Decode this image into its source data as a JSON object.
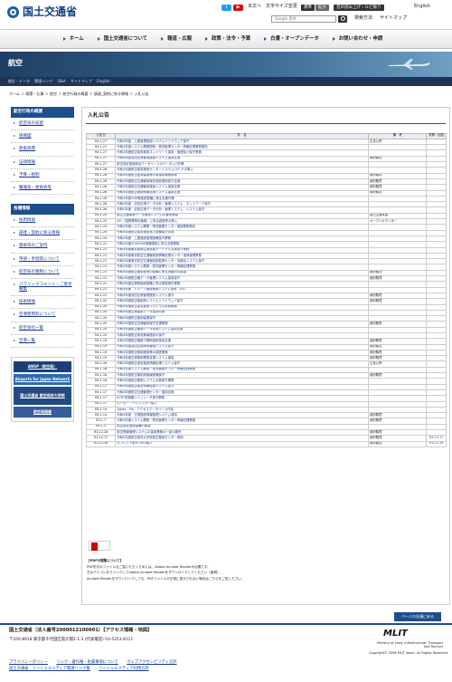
{
  "header": {
    "logo": "国土交通省",
    "text_size": "本文へ　文字サイズ変更",
    "size_std": "標準",
    "size_big": "拡大",
    "voice": "音声読み上げ・ルビ振り",
    "english": "English",
    "search_placeholder": "Google 提供",
    "search_guide": "検索方法",
    "sitemap": "サイトマップ"
  },
  "nav": [
    "ホーム",
    "国土交通省について",
    "報道・広報",
    "政策・法令・予算",
    "白書・オープンデータ",
    "お問い合わせ・申請"
  ],
  "banner": {
    "title": "航空"
  },
  "subnav": [
    "統計・データ",
    "関連リンク",
    "Q&A",
    "サイトマップ",
    "English"
  ],
  "breadcrumb": "ホーム ＞ 政策・仕事 ＞ 航空 ＞ 航空行政の概要 ＞ 調達_契約に係る情報 ＞ 入札公告",
  "side1": {
    "title": "航空行政の概要",
    "items": [
      "航空局の役割",
      "組織図",
      "政策目標",
      "法律情報",
      "予算・税制",
      "審議会・委員会等"
    ]
  },
  "side2": {
    "title": "各種情報",
    "items": [
      "採用情報",
      "調達・契約に係る情報",
      "資格等のご案内",
      "申請・手続等について",
      "航空局の税制について",
      "パブリックコメント・ご意見募集",
      "技術情報",
      "空港使用料について",
      "航空会社一覧",
      "空港一覧"
    ]
  },
  "banners": [
    "ANSP（航空局）",
    "Airports for Japan Network",
    "国土交通省 航空保安大学校",
    "航空局図書"
  ],
  "main": {
    "title": "入札公告",
    "cols": [
      "公告日",
      "件　名",
      "備　考",
      "質問・回答"
    ],
    "rows": [
      [
        "R4.1.27",
        "令和4年度　上屋管理施設システムソフトウェア保守",
        "広島公所",
        ""
      ],
      [
        "R4.1.27",
        "令和4年度システム開発関係・物流管理センター情報処理業務委託",
        "",
        ""
      ],
      [
        "R4.1.27",
        "令和4年度航空保安施設ネットワーク運用・管理及び保守業務",
        "",
        ""
      ],
      [
        "R4.1.27",
        "令和4年度羽田空港管理施設システム運用支援",
        "政府購買",
        ""
      ],
      [
        "R4.1.27",
        "航空保安施設統合データベースのデータ入力作業",
        "",
        ""
      ],
      [
        "R4.1.26",
        "令和4年度航空保安施設センターシステムCLP_その購入",
        "",
        ""
      ],
      [
        "R4.1.26",
        "令和4年度航空監視装置等の電源試験業務等",
        "政府購買",
        ""
      ],
      [
        "R4.1.26",
        "令和4年度航空交通管制保安施設運用保守支援",
        "政府購買",
        ""
      ],
      [
        "R4.1.26",
        "令和4年度航空交通管制施設システム運用支援",
        "政府購買",
        ""
      ],
      [
        "R4.1.26",
        "令和4年度航空管制情報処理システム運用支援",
        "政府購買",
        ""
      ],
      [
        "R4.1.26",
        "令和4年度CNS等施設整備に係る支援作業",
        "",
        ""
      ],
      [
        "R4.1.26",
        "令和4年度　羽田空港データ分析・管理システム　ネットワーク保守",
        "",
        ""
      ],
      [
        "R4.1.26",
        "令和4年度　羽田空港データ分析・管理システム　システム保守",
        "",
        ""
      ],
      [
        "R4.1.25",
        "航空交通事業データ管理システムの管理業務",
        "国土交通本省",
        ""
      ],
      [
        "R4.1.25",
        "ISO（国際標準化機構）に係る調査等の購入",
        "オープンカウンター",
        ""
      ],
      [
        "R4.1.24",
        "令和4年度システム開発・物流管理センター実施業務委託",
        "",
        ""
      ],
      [
        "R4.1.24",
        "令和4年度航空保安施設電力設備保守点検",
        "",
        ""
      ],
      [
        "R4.1.24",
        "令和4年度　上屋施設管理設備保守業務",
        "",
        ""
      ],
      [
        "R4.1.21",
        "令和4年度VOR/DME機器更新に係る支援業務",
        "",
        ""
      ],
      [
        "R4.1.21",
        "令和4年度東京国際空港旅客ターミナル点検保守業務",
        "",
        ""
      ],
      [
        "R4.1.21",
        "令和4年度東京航空交通管制部情報処理センター運用管理業務",
        "",
        ""
      ],
      [
        "R4.1.21",
        "令和4年度東京航空交通管制部監視センター自動化システム保守",
        "",
        ""
      ],
      [
        "R4.1.21",
        "令和4年度システム開発・物流管理センター情報処理業務",
        "",
        ""
      ],
      [
        "R4.1.21",
        "令和4年度航空管制官等の訓練に係る資機材の調達",
        "政府購買",
        ""
      ],
      [
        "R4.1.21",
        "令和4年度航空機データ管理システム運用保守",
        "政府購買",
        ""
      ],
      [
        "R4.1.21",
        "令和4年度空港等施設整備に係る調査検討業務",
        "",
        ""
      ],
      [
        "R4.1.21",
        "令和4年度　ドローン管理業務システム改修（2件）",
        "",
        ""
      ],
      [
        "R4.1.21",
        "令和4年度羽田空港管理施設システム保守",
        "政府購買",
        ""
      ],
      [
        "R4.1.20",
        "令和4年度航空管制用システムソフトウェア保守",
        "政府購買",
        ""
      ],
      [
        "R4.1.20",
        "令和4年度航空保安施設プログラム改修業務",
        "",
        ""
      ],
      [
        "R4.1.20",
        "令和4年度空港運用データ更新作業",
        "",
        ""
      ],
      [
        "R4.1.20",
        "令和4年度航空管制装置保守",
        "",
        ""
      ],
      [
        "R4.1.20",
        "令和4年度航空交通管制保守支援業務",
        "政府購買",
        ""
      ],
      [
        "R4.1.20",
        "令和4年度航空管制データ処理システム運用支援",
        "",
        ""
      ],
      [
        "R4.1.20",
        "令和4年度航空保安無線施設の保守",
        "",
        ""
      ],
      [
        "R4.1.19",
        "令和4年度航空機航行援助施設運用支援",
        "政府購買",
        ""
      ],
      [
        "R4.1.19",
        "令和4年度羽田空港用地管理システム保守",
        "政府購買",
        ""
      ],
      [
        "R4.1.19",
        "令和4年度航空管制施設等の調査業務",
        "政府購買",
        ""
      ],
      [
        "R4.1.19",
        "令和4年度空港管制業務支援システム運用",
        "政府購買",
        ""
      ],
      [
        "R4.1.18",
        "令和4年度航空保安施設情報処理システム保守",
        "広島公所",
        ""
      ],
      [
        "R4.1.18",
        "令和4年度システム開発・物流管理センター情報処理業務",
        "",
        ""
      ],
      [
        "R4.1.18",
        "令和4年度航空管制用無線設備保守",
        "政府購買",
        ""
      ],
      [
        "R4.1.18",
        "令和4年度航空管制システム点検保守業務",
        "",
        ""
      ],
      [
        "R4.1.17",
        "令和4年度航空保安情報処理システム保守",
        "",
        ""
      ],
      [
        "R4.1.17",
        "令和4年度航空交通管理センター運用支援",
        "",
        ""
      ],
      [
        "R4.1.17",
        "B787型模擬シミュレータ保守業務",
        "",
        ""
      ],
      [
        "R4.1.17",
        "ローター・ヘリコプター購入",
        "",
        ""
      ],
      [
        "R4.1.14",
        "Tablet　Pro　アクセスデータベース作成",
        "",
        ""
      ],
      [
        "R4.1.14",
        "令和4年度　空港施設情報管理システム運用",
        "政府購買",
        ""
      ],
      [
        "R4.1.7",
        "令和4年度システム開発・物流管理センター情報処理業務",
        "政府購買",
        ""
      ],
      [
        "R4.1.5",
        "航空保安施設整備の調達",
        "",
        ""
      ],
      [
        "R3.12.28",
        "航空情報管理システムの運用業務の一部の委託",
        "政府購買",
        ""
      ],
      [
        "R3.12.17",
        "令和4年度航空保安大学校航空管制センター使用",
        "政府購買",
        "R3.12.17"
      ],
      [
        "R3.12.16",
        "タブレット型PC24の購入",
        "政府購買",
        "R3.12.16"
      ]
    ]
  },
  "pdf_note": [
    "【PDFの閲覧について】",
    "PDF形式のファイルをご覧いただくためには、Adobe Acrobat Readerが必要です。",
    "左のアイコンをクリックしてAdobe Acrobat Readerをダウンロードしてください（無償）。",
    "Acrobat Readerをダウンロードしても、PDFファイルが正常に表示されない場合はこちらをご覧ください。"
  ],
  "pagetop": "ページの先頭に戻る",
  "footer": {
    "org": "国土交通省（法人番号2000012100001）【アクセス情報・地図】",
    "address": "〒100-8918 東京都千代田区霞が関2-1-3 (代表電話) 03-5253-8111",
    "copyright": "Copyright© 2008 MLIT Japan. All Rights Reserved.",
    "mlit": "MLIT",
    "mlit_sub": "Ministry of Land, Infrastructure, Transport and Tourism",
    "links": [
      "プライバシーポリシー",
      "リンク・著作権・免責事項について",
      "ウェブアクセシビリティ方針",
      "国土交通省　ソーシャルメディア関連リンク集",
      "ソーシャルメディア利用方針"
    ]
  }
}
